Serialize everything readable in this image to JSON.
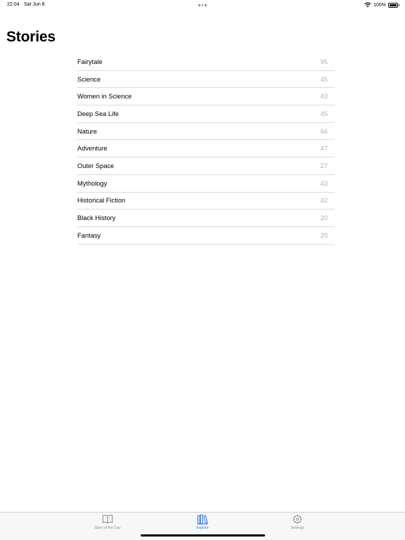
{
  "status_bar": {
    "time": "22:04",
    "date": "Sat Jun 8",
    "battery": "100%"
  },
  "page": {
    "title": "Stories"
  },
  "categories": [
    {
      "label": "Fairytale",
      "count": "95"
    },
    {
      "label": "Science",
      "count": "45"
    },
    {
      "label": "Women in Science",
      "count": "43"
    },
    {
      "label": "Deep Sea Life",
      "count": "45"
    },
    {
      "label": "Nature",
      "count": "66"
    },
    {
      "label": "Adventure",
      "count": "47"
    },
    {
      "label": "Outer Space",
      "count": "27"
    },
    {
      "label": "Mythology",
      "count": "43"
    },
    {
      "label": "Historical Fiction",
      "count": "42"
    },
    {
      "label": "Black History",
      "count": "20"
    },
    {
      "label": "Fantasy",
      "count": "20"
    }
  ],
  "tab_bar": {
    "tabs": [
      {
        "label": "Story of the Day",
        "icon": "book-icon",
        "active": false
      },
      {
        "label": "Explore",
        "icon": "books-icon",
        "active": true
      },
      {
        "label": "Settings",
        "icon": "gear-icon",
        "active": false
      }
    ]
  },
  "colors": {
    "accent": "#3478f6",
    "inactive": "#8e8e93",
    "count": "#b0b0b4"
  }
}
